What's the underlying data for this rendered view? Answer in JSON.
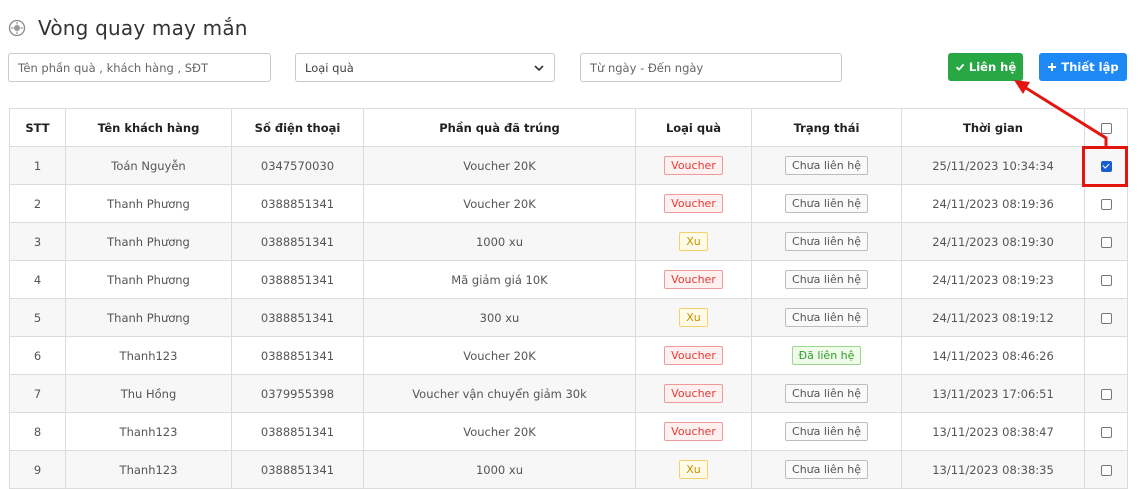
{
  "header": {
    "title": "Vòng quay may mắn",
    "icon": "settings-wheel-icon"
  },
  "filters": {
    "search_placeholder": "Tên phần quà , khách hàng , SĐT",
    "gift_type_selected": "Loại quà",
    "date_range_placeholder": "Từ ngày - Đến ngày"
  },
  "buttons": {
    "contact_label": "Liên hệ",
    "settings_label": "Thiết lập",
    "contact_color": "#28a745",
    "settings_color": "#1e88f5"
  },
  "table": {
    "headers": [
      "STT",
      "Tên khách hàng",
      "Số điện thoại",
      "Phần quà đã trúng",
      "Loại quà",
      "Trạng thái",
      "Thời gian"
    ],
    "rows": [
      {
        "stt": "1",
        "customer": "Toán Nguyễn",
        "phone": "0347570030",
        "gift": "Voucher 20K",
        "type": "Voucher",
        "status": "Chưa liên hệ",
        "time": "25/11/2023 10:34:34",
        "checked": true
      },
      {
        "stt": "2",
        "customer": "Thanh Phương",
        "phone": "0388851341",
        "gift": "Voucher 20K",
        "type": "Voucher",
        "status": "Chưa liên hệ",
        "time": "24/11/2023 08:19:36",
        "checked": false
      },
      {
        "stt": "3",
        "customer": "Thanh Phương",
        "phone": "0388851341",
        "gift": "1000 xu",
        "type": "Xu",
        "status": "Chưa liên hệ",
        "time": "24/11/2023 08:19:30",
        "checked": false
      },
      {
        "stt": "4",
        "customer": "Thanh Phương",
        "phone": "0388851341",
        "gift": "Mã giảm giá 10K",
        "type": "Voucher",
        "status": "Chưa liên hệ",
        "time": "24/11/2023 08:19:23",
        "checked": false
      },
      {
        "stt": "5",
        "customer": "Thanh Phương",
        "phone": "0388851341",
        "gift": "300 xu",
        "type": "Xu",
        "status": "Chưa liên hệ",
        "time": "24/11/2023 08:19:12",
        "checked": false
      },
      {
        "stt": "6",
        "customer": "Thanh123",
        "phone": "0388851341",
        "gift": "Voucher 20K",
        "type": "Voucher",
        "status": "Đã liên hệ",
        "time": "14/11/2023 08:46:26",
        "checked": null
      },
      {
        "stt": "7",
        "customer": "Thu Hồng",
        "phone": "0379955398",
        "gift": "Voucher vận chuyển giảm 30k",
        "type": "Voucher",
        "status": "Chưa liên hệ",
        "time": "13/11/2023 17:06:51",
        "checked": false
      },
      {
        "stt": "8",
        "customer": "Thanh123",
        "phone": "0388851341",
        "gift": "Voucher 20K",
        "type": "Voucher",
        "status": "Chưa liên hệ",
        "time": "13/11/2023 08:38:47",
        "checked": false
      },
      {
        "stt": "9",
        "customer": "Thanh123",
        "phone": "0388851341",
        "gift": "1000 xu",
        "type": "Xu",
        "status": "Chưa liên hệ",
        "time": "13/11/2023 08:38:35",
        "checked": false
      }
    ]
  },
  "annotation": {
    "color": "#e3160f"
  }
}
